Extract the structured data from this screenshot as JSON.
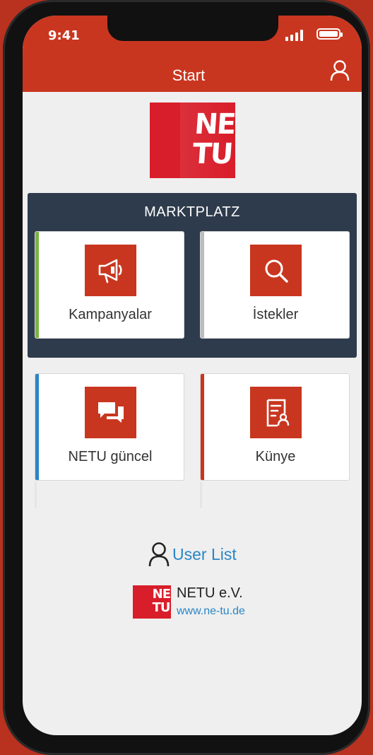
{
  "status_bar": {
    "time": "9:41",
    "icons": [
      "signal-icon",
      "battery-icon"
    ]
  },
  "app_bar": {
    "title": "Start",
    "profile_icon": "user-icon"
  },
  "logo": {
    "line1": "NE",
    "line2": "TU"
  },
  "marketplace": {
    "title": "MARKTPLATZ",
    "tiles": [
      {
        "label": "Kampanyalar",
        "icon": "megaphone-icon",
        "stripe_color": "#7cb342"
      },
      {
        "label": "İstekler",
        "icon": "search-icon",
        "stripe_color": "#b9bcc1"
      }
    ]
  },
  "tiles": [
    {
      "label": "NETU güncel",
      "icon": "chat-icon",
      "stripe_color": "#2a86c6"
    },
    {
      "label": "Künye",
      "icon": "id-document-icon",
      "stripe_color": "#c9361f"
    }
  ],
  "user_list": {
    "label": "User List",
    "icon": "user-icon"
  },
  "footer": {
    "logo_line1": "NE",
    "logo_line2": "TU",
    "name": "NETU e.V.",
    "url": "www.ne-tu.de"
  },
  "colors": {
    "brand_red": "#c9361f",
    "panel_dark": "#2e3b4c",
    "link_blue": "#2a86c6"
  }
}
